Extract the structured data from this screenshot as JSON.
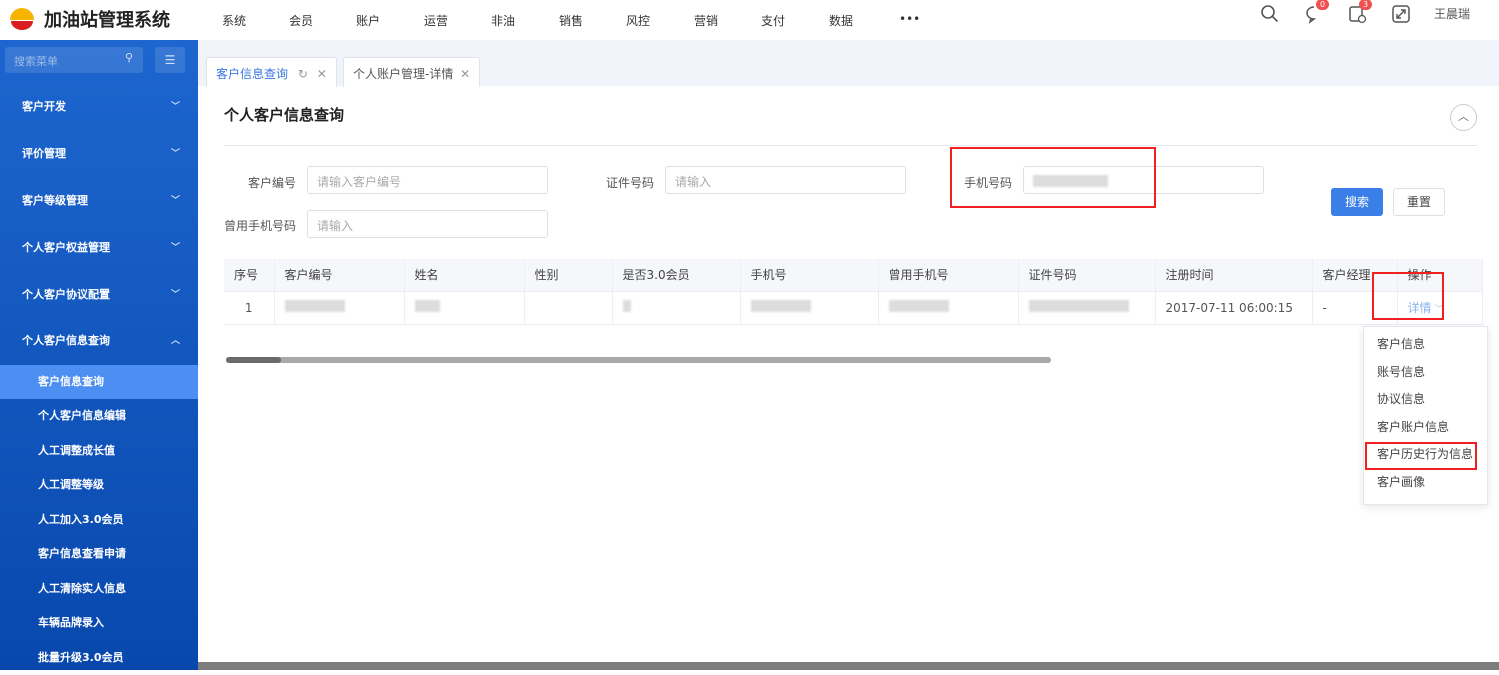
{
  "header": {
    "brand": "加油站管理系统",
    "nav": [
      "系统",
      "会员",
      "账户",
      "运营",
      "非油",
      "销售",
      "风控",
      "营销",
      "支付",
      "数据",
      "•••"
    ],
    "msg_badge": "0",
    "task_badge": "3",
    "user": "王晨瑞"
  },
  "sidebar": {
    "search_placeholder": "搜索菜单",
    "menus": [
      "客户开发",
      "评价管理",
      "客户等级管理",
      "个人客户权益管理",
      "个人客户协议配置",
      "个人客户信息查询"
    ],
    "subitems": [
      "客户信息查询",
      "个人客户信息编辑",
      "人工调整成长值",
      "人工调整等级",
      "人工加入3.0会员",
      "客户信息查看申请",
      "人工清除实人信息",
      "车辆品牌录入",
      "批量升级3.0会员"
    ]
  },
  "tabs": [
    "客户信息查询",
    "个人账户管理-详情"
  ],
  "page": {
    "title": "个人客户信息查询"
  },
  "form": {
    "customer_no_label": "客户编号",
    "customer_no_placeholder": "请输入客户编号",
    "id_label": "证件号码",
    "id_placeholder": "请输入",
    "phone_label": "手机号码",
    "old_phone_label": "曾用手机号码",
    "old_phone_placeholder": "请输入",
    "search": "搜索",
    "reset": "重置"
  },
  "table": {
    "headers": [
      "序号",
      "客户编号",
      "姓名",
      "性别",
      "是否3.0会员",
      "手机号",
      "曾用手机号",
      "证件号码",
      "注册时间",
      "客户经理",
      "操作"
    ],
    "row": {
      "index": "1",
      "reg_time": "2017-07-11 06:00:15",
      "manager": "-",
      "action": "详情"
    }
  },
  "dropdown": [
    "客户信息",
    "账号信息",
    "协议信息",
    "客户账户信息",
    "客户历史行为信息",
    "客户画像"
  ],
  "colors": {
    "primary": "#3a78e0",
    "sidebar": "#1d66cf",
    "highlight": "#f02020"
  }
}
